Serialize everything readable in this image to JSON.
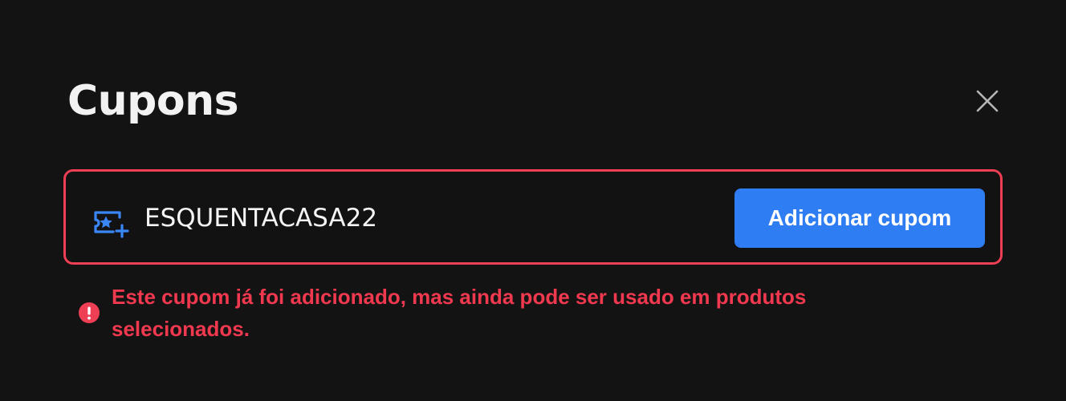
{
  "modal": {
    "title": "Cupons"
  },
  "coupon": {
    "value": "ESQUENTACASA22",
    "button_label": "Adicionar cupom",
    "icon": "coupon-ticket-star-plus-icon"
  },
  "error": {
    "message": "Este cupom já foi adicionado, mas ainda pode ser usado em produtos selecionados.",
    "icon": "error-exclamation-icon"
  },
  "colors": {
    "background": "#131313",
    "accent": "#2f7df2",
    "error": "#ee3f55",
    "text": "#f2f2f2"
  }
}
